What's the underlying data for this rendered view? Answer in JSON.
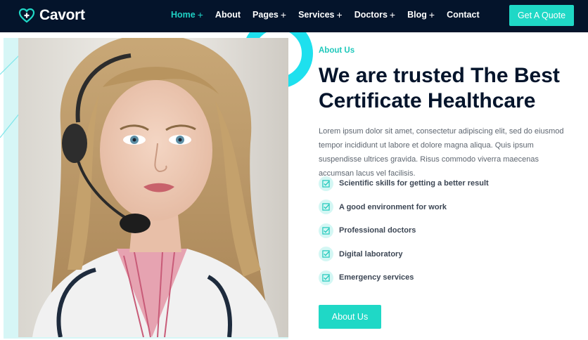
{
  "brand": {
    "name": "Cavort",
    "icon": "heart-plus-icon"
  },
  "nav": {
    "items": [
      {
        "label": "Home",
        "has_submenu": true,
        "active": true
      },
      {
        "label": "About",
        "has_submenu": false,
        "active": false
      },
      {
        "label": "Pages",
        "has_submenu": true,
        "active": false
      },
      {
        "label": "Services",
        "has_submenu": true,
        "active": false
      },
      {
        "label": "Doctors",
        "has_submenu": true,
        "active": false
      },
      {
        "label": "Blog",
        "has_submenu": true,
        "active": false
      },
      {
        "label": "Contact",
        "has_submenu": false,
        "active": false
      }
    ],
    "submenu_glyph": "+",
    "cta_label": "Get A Quote"
  },
  "about": {
    "eyebrow": "About Us",
    "heading": "We are trusted The Best Certificate Healthcare",
    "lead": "Lorem ipsum dolor sit amet, consectetur adipiscing elit, sed do eiusmod tempor incididunt ut labore et dolore magna aliqua. Quis ipsum suspendisse ultrices gravida. Risus commodo viverra maecenas accumsan lacus vel facilisis.",
    "features": [
      "Scientific skills for getting a better result",
      "A good environment for work",
      "Professional doctors",
      "Digital laboratory",
      "Emergency services"
    ],
    "button_label": "About Us"
  },
  "colors": {
    "navbar_bg": "#04142b",
    "accent": "#1fd8c6",
    "heading": "#04142b",
    "body_text": "#5e6670"
  }
}
